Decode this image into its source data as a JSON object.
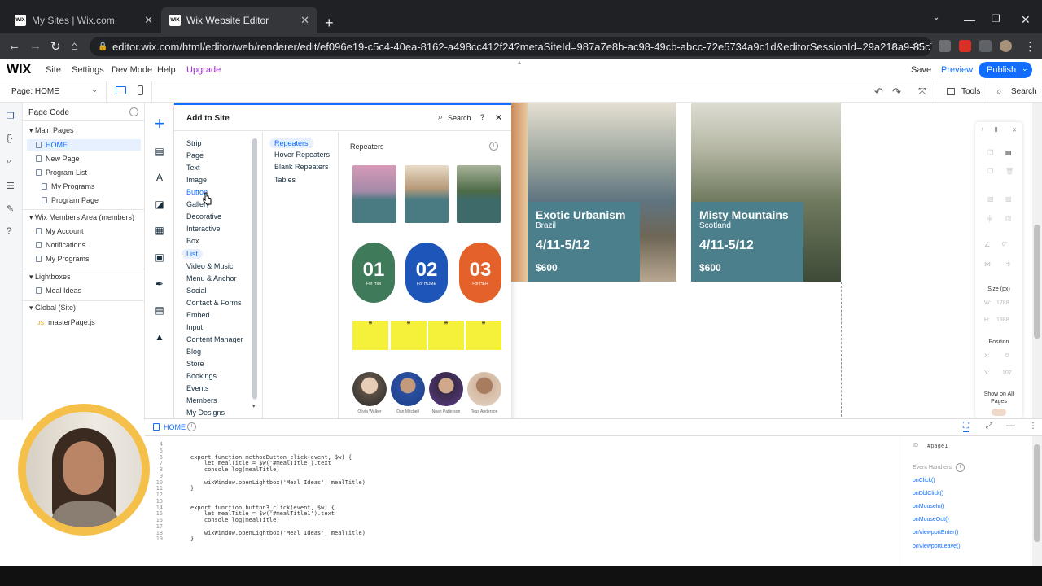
{
  "browser": {
    "tabs": [
      {
        "title": "My Sites | Wix.com",
        "favicon": "WIX"
      },
      {
        "title": "Wix Website Editor",
        "favicon": "WIX"
      }
    ],
    "new_tab": "+",
    "url": "editor.wix.com/html/editor/web/renderer/edit/ef096e19-c5c4-40ea-8162-a498cc412f24?metaSiteId=987a7e8b-ac98-49cb-abcc-72e5734a9c1d&editorSessionId=29a218a9-85c7-46c6-aaa9-..."
  },
  "wix_menu": {
    "logo": "WIX",
    "items": [
      "Site",
      "Settings",
      "Dev Mode",
      "Help",
      "Upgrade"
    ],
    "save": "Save",
    "preview": "Preview",
    "publish": "Publish",
    "upgrade_color": "#9a27d5"
  },
  "page_bar": {
    "page_label": "Page: HOME",
    "tools": "Tools",
    "search": "Search"
  },
  "page_code": {
    "title": "Page Code",
    "sections": [
      {
        "label": "Main Pages",
        "items": [
          "HOME",
          "New Page",
          "Program List",
          "My Programs",
          "Program Page"
        ]
      },
      {
        "label": "Wix Members Area (members)",
        "items": [
          "My Account",
          "Notifications",
          "My Programs"
        ]
      },
      {
        "label": "Lightboxes",
        "items": [
          "Meal Ideas"
        ]
      },
      {
        "label": "Global (Site)",
        "items": [
          "masterPage.js"
        ]
      }
    ]
  },
  "add_panel": {
    "title": "Add to Site",
    "search": "Search",
    "help": "?",
    "categories": [
      "Strip",
      "Page",
      "Text",
      "Image",
      "Button",
      "Gallery",
      "Decorative",
      "Interactive",
      "Box",
      "List",
      "Video & Music",
      "Menu & Anchor",
      "Social",
      "Contact & Forms",
      "Embed",
      "Input",
      "Content Manager",
      "Blog",
      "Store",
      "Bookings",
      "Events",
      "Members",
      "My Designs"
    ],
    "subcategories": [
      "Repeaters",
      "Hover Repeaters",
      "Blank Repeaters",
      "Tables"
    ],
    "section_title": "Repeaters",
    "number_pills": [
      {
        "num": "01",
        "caption": "For HIM",
        "color": "#3f7a5a"
      },
      {
        "num": "02",
        "caption": "For HOME",
        "color": "#1d55b8"
      },
      {
        "num": "03",
        "caption": "For HER",
        "color": "#e4622a"
      }
    ],
    "people": [
      "Olivia Walker",
      "Dan Mitchell",
      "Noah Patterson",
      "Tess Anderson"
    ]
  },
  "canvas": {
    "cards": [
      {
        "title": "Exotic Urbanism",
        "country": "Brazil",
        "dates": "4/11-5/12",
        "price": "$600"
      },
      {
        "title": "Misty Mountains",
        "country": "Scotland",
        "dates": "4/11-5/12",
        "price": "$600"
      }
    ]
  },
  "inspector": {
    "size_label": "Size (px)",
    "w_label": "W:",
    "w_value": "1788",
    "h_label": "H:",
    "h_value": "1388",
    "position_label": "Position",
    "x_label": "X:",
    "x_value": "0",
    "y_label": "Y:",
    "y_value": "107",
    "show_on_all": "Show on All Pages",
    "rotation": "0°"
  },
  "code_panel": {
    "tab": "HOME",
    "lines": [
      {
        "n": "4",
        "text": ""
      },
      {
        "n": "5",
        "text": ""
      },
      {
        "n": "6",
        "text": "export function methodButton_click(event, $w) {"
      },
      {
        "n": "7",
        "text": "    let mealTitle = $w('#mealTitle').text"
      },
      {
        "n": "8",
        "text": "    console.log(mealTitle)"
      },
      {
        "n": "9",
        "text": ""
      },
      {
        "n": "10",
        "text": "    wixWindow.openLightbox('Meal Ideas', mealTitle)"
      },
      {
        "n": "11",
        "text": "}"
      },
      {
        "n": "12",
        "text": ""
      },
      {
        "n": "13",
        "text": ""
      },
      {
        "n": "14",
        "text": "export function button3_click(event, $w) {"
      },
      {
        "n": "15",
        "text": "    let mealTitle = $w('#mealTitle1').text"
      },
      {
        "n": "16",
        "text": "    console.log(mealTitle)"
      },
      {
        "n": "17",
        "text": ""
      },
      {
        "n": "18",
        "text": "    wixWindow.openLightbox('Meal Ideas', mealTitle)"
      },
      {
        "n": "19",
        "text": "}"
      }
    ],
    "props_id_label": "ID",
    "props_id": "#page1",
    "event_handlers_label": "Event Handlers",
    "event_handlers": [
      "onClick()",
      "onDblClick()",
      "onMouseIn()",
      "onMouseOut()",
      "onViewportEnter()",
      "onViewportLeave()"
    ]
  },
  "colors": {
    "accent": "#116dff",
    "card_panel": "#4b7f8c",
    "browser_dark": "#202124"
  }
}
